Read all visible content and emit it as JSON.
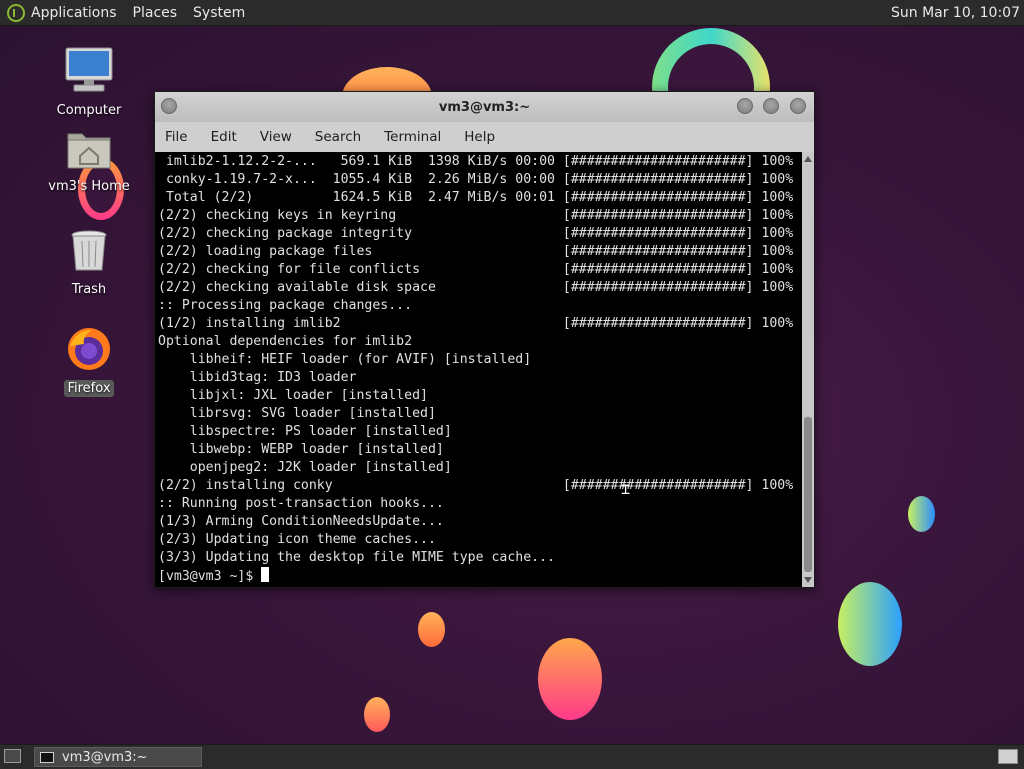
{
  "top_panel": {
    "menus": [
      "Applications",
      "Places",
      "System"
    ],
    "clock": "Sun Mar 10, 10:07"
  },
  "desktop_icons": [
    {
      "label": "Computer",
      "icon": "computer-icon"
    },
    {
      "label": "vm3's Home",
      "icon": "home-folder-icon"
    },
    {
      "label": "Trash",
      "icon": "trash-icon"
    },
    {
      "label": "Firefox",
      "icon": "firefox-icon"
    }
  ],
  "window": {
    "title": "vm3@vm3:~",
    "menus": [
      "File",
      "Edit",
      "View",
      "Search",
      "Terminal",
      "Help"
    ]
  },
  "terminal_lines": [
    " imlib2-1.12.2-2-...   569.1 KiB  1398 KiB/s 00:00 [######################] 100%",
    " conky-1.19.7-2-x...  1055.4 KiB  2.26 MiB/s 00:00 [######################] 100%",
    " Total (2/2)          1624.5 KiB  2.47 MiB/s 00:01 [######################] 100%",
    "(2/2) checking keys in keyring                     [######################] 100%",
    "(2/2) checking package integrity                   [######################] 100%",
    "(2/2) loading package files                        [######################] 100%",
    "(2/2) checking for file conflicts                  [######################] 100%",
    "(2/2) checking available disk space                [######################] 100%",
    ":: Processing package changes...",
    "(1/2) installing imlib2                            [######################] 100%",
    "Optional dependencies for imlib2",
    "    libheif: HEIF loader (for AVIF) [installed]",
    "    libid3tag: ID3 loader",
    "    libjxl: JXL loader [installed]",
    "    librsvg: SVG loader [installed]",
    "    libspectre: PS loader [installed]",
    "    libwebp: WEBP loader [installed]",
    "    openjpeg2: J2K loader [installed]",
    "(2/2) installing conky                             [######################] 100%",
    ":: Running post-transaction hooks...",
    "(1/3) Arming ConditionNeedsUpdate...",
    "(2/3) Updating icon theme caches...",
    "(3/3) Updating the desktop file MIME type cache..."
  ],
  "prompt": "[vm3@vm3 ~]$ ",
  "taskbar": {
    "task_label": "vm3@vm3:~"
  }
}
